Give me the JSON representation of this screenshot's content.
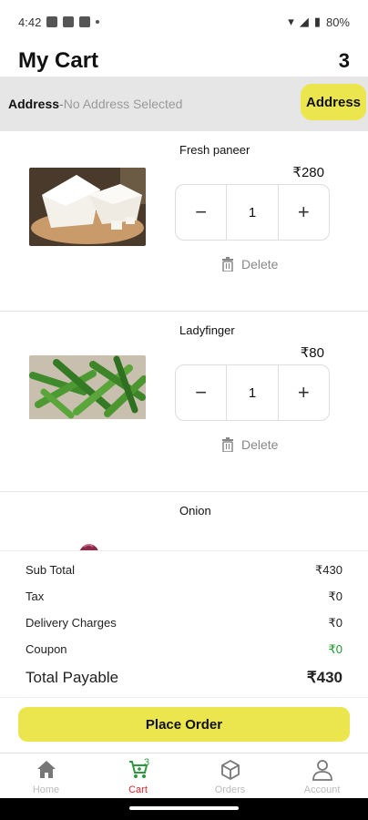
{
  "status_bar": {
    "time": "4:42",
    "battery": "80%"
  },
  "header": {
    "title": "My Cart",
    "count": "3"
  },
  "address": {
    "label": "Address",
    "separator": "-",
    "value": "No Address Selected",
    "button_label": "Address"
  },
  "cart_items": [
    {
      "name": "Fresh paneer",
      "price": "₹280",
      "quantity": "1",
      "delete_label": "Delete"
    },
    {
      "name": "Ladyfinger",
      "price": "₹80",
      "quantity": "1",
      "delete_label": "Delete"
    },
    {
      "name": "Onion"
    }
  ],
  "stepper": {
    "minus": "−",
    "plus": "+"
  },
  "summary": {
    "sub_total_label": "Sub Total",
    "sub_total": "₹430",
    "tax_label": "Tax",
    "tax": "₹0",
    "delivery_label": "Delivery Charges",
    "delivery": "₹0",
    "coupon_label": "Coupon",
    "coupon": "₹0",
    "total_label": "Total Payable",
    "total": "₹430"
  },
  "place_order_label": "Place Order",
  "nav": {
    "items": [
      {
        "label": "Home",
        "icon": "home-icon"
      },
      {
        "label": "Cart",
        "icon": "cart-icon",
        "badge": "3"
      },
      {
        "label": "Orders",
        "icon": "box-icon"
      },
      {
        "label": "Account",
        "icon": "user-icon"
      }
    ]
  },
  "colors": {
    "accent": "#ebe64d",
    "active_nav": "#d12b2b",
    "coupon": "#1a9a2a",
    "address_bar": "#e6e6e6"
  }
}
